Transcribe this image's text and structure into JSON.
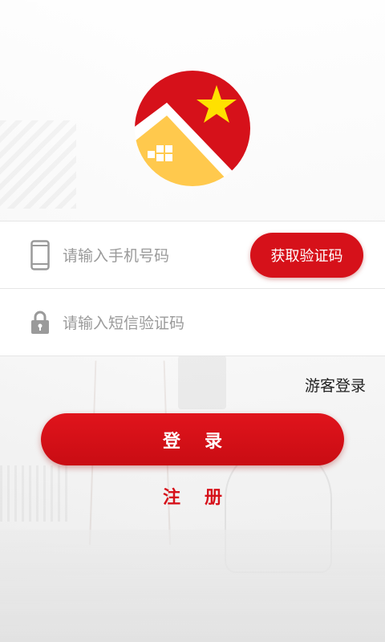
{
  "logo": {
    "icon": "house-star-logo",
    "colors": {
      "red": "#d6111a",
      "yellow": "#ffc94d",
      "white": "#ffffff"
    }
  },
  "form": {
    "phone": {
      "placeholder": "请输入手机号码",
      "value": "",
      "icon": "phone-icon"
    },
    "get_code_label": "获取验证码",
    "sms": {
      "placeholder": "请输入短信验证码",
      "value": "",
      "icon": "lock-icon"
    }
  },
  "guest_login_label": "游客登录",
  "login_label": "登录",
  "register_label": "注册",
  "colors": {
    "accent": "#d6111a",
    "placeholder": "#9a9a9a"
  }
}
